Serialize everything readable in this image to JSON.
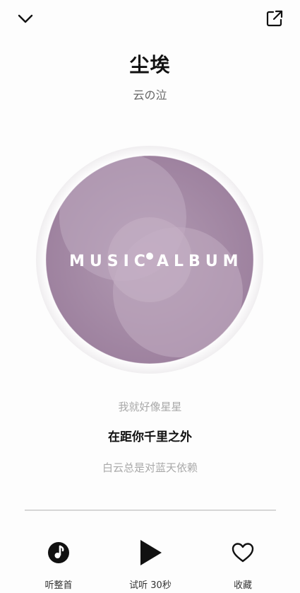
{
  "song": {
    "title": "尘埃",
    "artist": "云の泣"
  },
  "cover": {
    "left_text": "MUSIC",
    "right_text": "ALBUM",
    "color": "#a58aa6"
  },
  "lyrics": {
    "previous": "我就好像星星",
    "current": "在距你千里之外",
    "next": "白云总是对蓝天依赖"
  },
  "playback": {
    "progress_fraction": 0
  },
  "actions": {
    "full_song": "听整首",
    "preview": "试听 30秒",
    "favorite": "收藏"
  },
  "icons": {
    "collapse": "chevron-down-icon",
    "share": "share-external-icon",
    "full_song": "music-note-icon",
    "preview": "play-icon",
    "favorite": "heart-icon"
  }
}
